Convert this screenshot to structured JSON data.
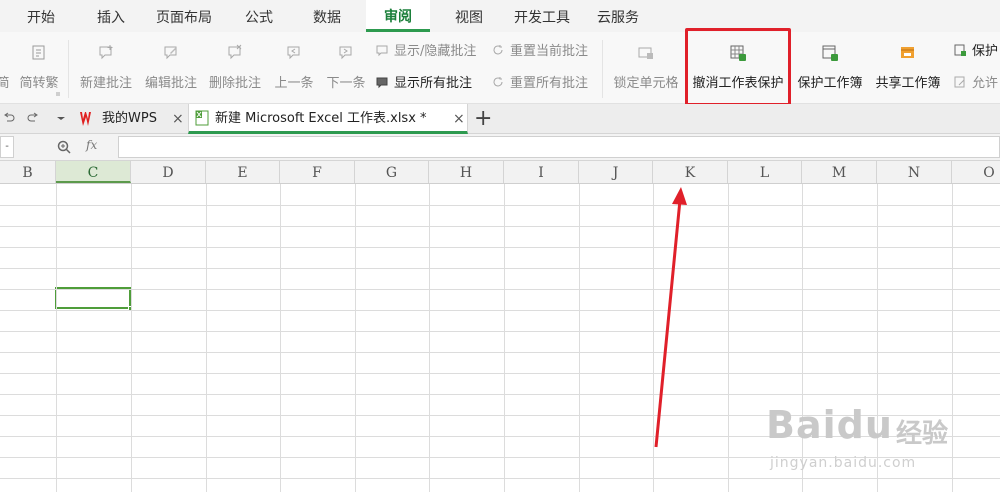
{
  "menu": {
    "tabs": [
      "开始",
      "插入",
      "页面布局",
      "公式",
      "数据",
      "审阅",
      "视图",
      "开发工具",
      "云服务"
    ],
    "active": "审阅"
  },
  "ribbon": {
    "jian": "简",
    "jianzhuanfan": "简转繁",
    "new_comment": "新建批注",
    "edit_comment": "编辑批注",
    "delete_comment": "删除批注",
    "prev": "上一条",
    "next": "下一条",
    "show_hide_comment": "显示/隐藏批注",
    "show_all_comments": "显示所有批注",
    "reset_current": "重置当前批注",
    "reset_all": "重置所有批注",
    "lock_cell": "锁定单元格",
    "unprotect_sheet": "撤消工作表保护",
    "protect_workbook": "保护工作簿",
    "share_workbook": "共享工作簿",
    "protect_partial": "保护",
    "allow_partial": "允许",
    "highlight_color": "#e0202a"
  },
  "tabs": {
    "wps_label": "我的WPS",
    "doc_label": "新建 Microsoft Excel 工作表.xlsx *",
    "close_glyph": "×",
    "add_glyph": "+",
    "wps_brand_color": "#e02020"
  },
  "formula": {
    "fx": "fx",
    "name_value": "-"
  },
  "sheet": {
    "columns": [
      "B",
      "C",
      "D",
      "E",
      "F",
      "G",
      "H",
      "I",
      "J",
      "K",
      "L",
      "M",
      "N",
      "O"
    ],
    "selected_column": "C",
    "accent": "#4f9d3a"
  },
  "annotation": {
    "arrow_color": "#e0202a"
  },
  "watermark": {
    "brand": "Baidu",
    "cn": "经验",
    "url": "jingyan.baidu.com"
  }
}
